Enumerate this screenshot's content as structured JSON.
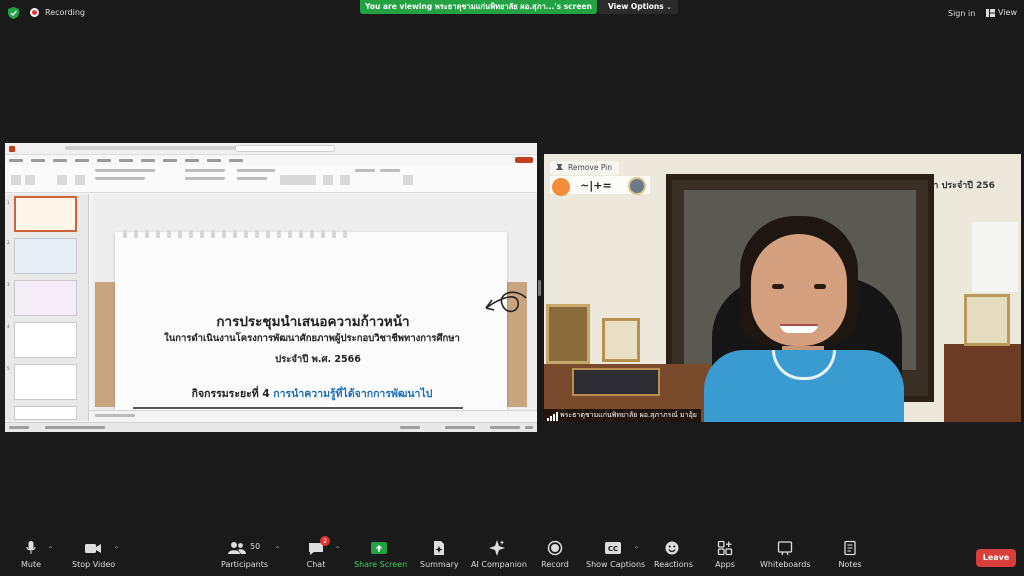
{
  "topbar": {
    "recording_label": "Recording",
    "viewing_banner": "You are viewing พระธาตุชามแก่นพิทยาลัย ผอ.สุภา...'s screen",
    "view_options_label": "View Options",
    "sign_in_label": "Sign in",
    "view_label": "View"
  },
  "slide": {
    "title": "การประชุมนำเสนอความก้าวหน้า",
    "subtitle_line1": "ในการดำเนินงานโครงการพัฒนาศักยภาพผู้ประกอบวิชาชีพทางการศึกษา",
    "subtitle_line2": "ประจำปี พ.ศ. 2566",
    "activity_prefix": "กิจกรรมระยะที่ 4",
    "activity_highlight": "การนำความรู้ที่ได้จากการพัฒนาไป"
  },
  "video": {
    "remove_pin_label": "Remove Pin",
    "logo_text": "~|+=",
    "banner_text": "กษา ประจำปี 256",
    "participant_name": "พระธาตุชามแก่นพิทยาลัย ผอ.สุภาภรณ์ มาอุ้ย"
  },
  "toolbar": {
    "mute": "Mute",
    "stop_video": "Stop Video",
    "participants": "Participants",
    "participants_count": "50",
    "chat": "Chat",
    "chat_badge": "2",
    "share_screen": "Share Screen",
    "summary": "Summary",
    "ai_companion": "AI Companion",
    "record": "Record",
    "show_captions": "Show Captions",
    "reactions": "Reactions",
    "apps": "Apps",
    "whiteboards": "Whiteboards",
    "notes": "Notes",
    "leave": "Leave"
  },
  "colors": {
    "share_green": "#23a244",
    "leave_red": "#d93f3a",
    "recording_red": "#e53935",
    "highlight_blue": "#1f6fb5"
  }
}
